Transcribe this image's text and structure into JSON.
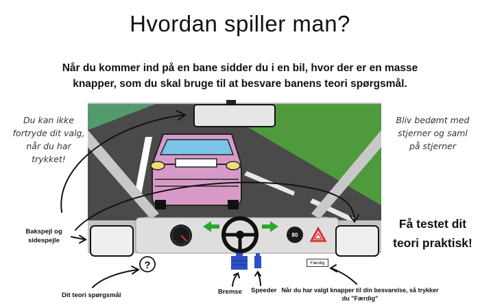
{
  "header": {
    "title": "Hvordan spiller man?",
    "intro": "Når du kommer ind på en bane sidder du i en bil, hvor der er en masse knapper, som du skal bruge til at besvare banens teori spørgsmål."
  },
  "notes": {
    "left": "Du kan ikke fortryde dit valg, når du har trykket!",
    "right": "Bliv bedømt med stjerner og saml på stjerner",
    "cta": "Få testet dit teori praktisk!"
  },
  "labels": {
    "mirrors": "Bakspejl og sidespejle",
    "question": "Dit teori spørgsmål",
    "brake": "Bremse",
    "speeder": "Speeder",
    "done_hint": "Når du har valgt knapper til din besvarelse, så trykker du \"Færdig\""
  },
  "dashboard": {
    "speed_sign": "80",
    "question_symbol": "?",
    "done_button": "Færdig"
  },
  "colors": {
    "grass": "#4f9a3c",
    "road": "#4a4a4a",
    "car": "#d79ac8",
    "dash": "#d4d4d4",
    "pedal": "#2d4fc9",
    "arrow": "#2aa82a"
  }
}
